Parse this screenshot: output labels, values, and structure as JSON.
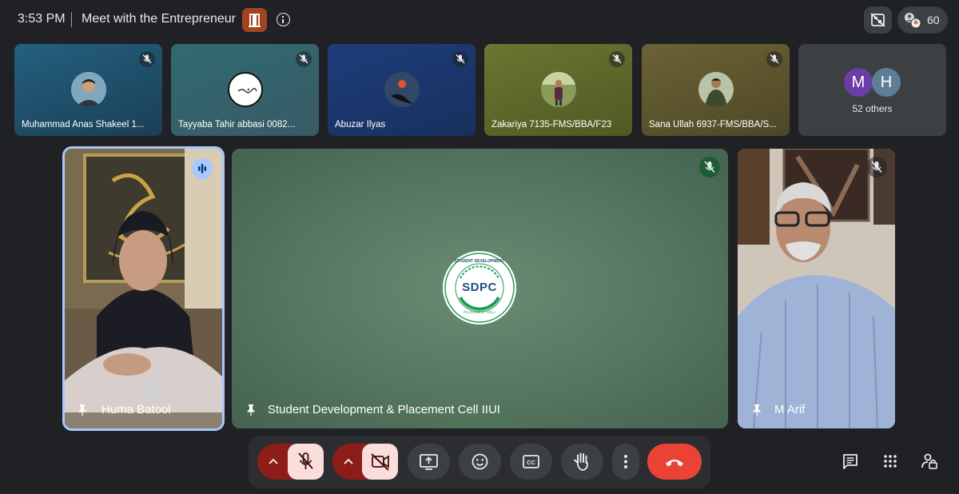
{
  "topbar": {
    "time": "3:53 PM",
    "meeting_title": "Meet with the Entrepreneur",
    "people_count": "60"
  },
  "strip": [
    {
      "name": "Muhammad Anas Shakeel 1...",
      "muted": true,
      "bg": "#1f4f6b"
    },
    {
      "name": "Tayyaba Tahir abbasi 0082...",
      "muted": true,
      "bg": "#2a5a60"
    },
    {
      "name": "Abuzar Ilyas",
      "muted": true,
      "bg": "#1e3a72"
    },
    {
      "name": "Zakariya 7135-FMS/BBA/F23",
      "muted": true,
      "bg": "#5f6a2a"
    },
    {
      "name": "Sana Ullah 6937-FMS/BBA/S...",
      "muted": true,
      "bg": "#5c5530"
    }
  ],
  "others": {
    "avatar_1": "M",
    "avatar_2": "H",
    "label": "52 others",
    "avatar_1_color": "#6a3da8",
    "avatar_2_color": "#5f7e95"
  },
  "main": {
    "left_name": "Huma Batool",
    "center_name": "Student Development & Placement Cell IIUI",
    "right_name": "M Arif",
    "logo_text": "SDPC",
    "logo_arc_top": "STUDENT DEVELOPMENT",
    "logo_arc_bottom": "PLACEMENT CELL"
  },
  "colors": {
    "background": "#202124",
    "speaking_border": "#a8c7fa",
    "end_call": "#ea4335",
    "muted_control": "#f9dedc",
    "muted_arrow": "#8c1d18",
    "sdpc_green": "#1e9d58"
  },
  "icons": {
    "mic": "mic-off-icon",
    "camera": "camera-off-icon",
    "present": "present-screen-icon",
    "emoji": "emoji-icon",
    "captions": "captions-icon",
    "hand": "raise-hand-icon",
    "more": "more-vert-icon",
    "end": "end-call-icon",
    "chat": "chat-icon",
    "activities": "activities-icon",
    "host": "host-controls-icon"
  }
}
